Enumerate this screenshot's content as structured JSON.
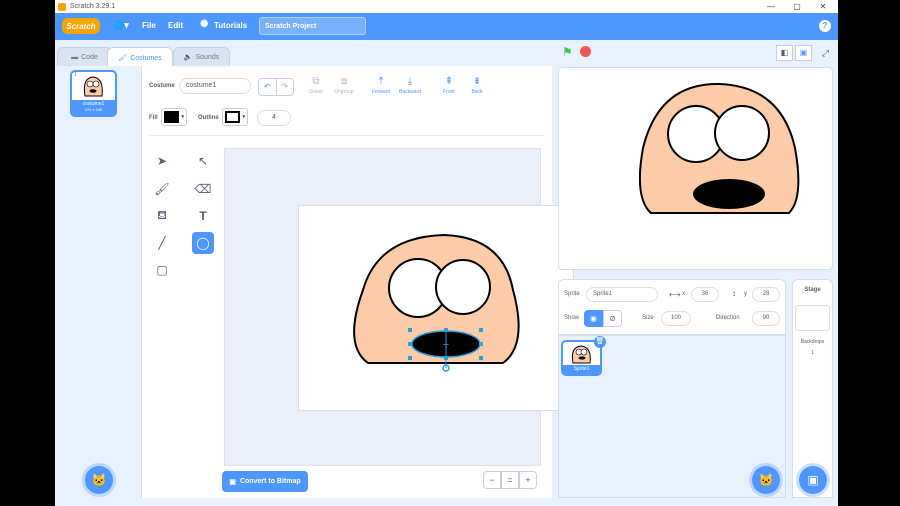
{
  "window": {
    "title": "Scratch 3.29.1",
    "minimize": "—",
    "maximize": "▢",
    "close": "✕"
  },
  "menubar": {
    "logo": "Scratch",
    "globe": "🌐▾",
    "file": "File",
    "edit": "Edit",
    "tutorials": "Tutorials",
    "project_title": "Scratch Project",
    "help": "?"
  },
  "tabs": {
    "code": "Code",
    "costumes": "Costumes",
    "sounds": "Sounds"
  },
  "costume_list": {
    "index": "1",
    "name": "costume1",
    "size": "274 x 240"
  },
  "paint": {
    "costume_label": "Costume",
    "costume_name": "costume1",
    "undo": "↶",
    "redo": "↷",
    "group": "Group",
    "ungroup": "Ungroup",
    "forward": "Forward",
    "backward": "Backward",
    "front": "Front",
    "back": "Back",
    "fill_label": "Fill",
    "outline_label": "Outline",
    "outline_width": "4",
    "convert_button": "Convert to Bitmap",
    "zoom_out": "−",
    "zoom_reset": "=",
    "zoom_in": "+",
    "tools": [
      "select-tool",
      "reshape-tool",
      "brush-tool",
      "eraser-tool",
      "fill-tool",
      "text-tool",
      "line-tool",
      "circle-tool",
      "rect-tool"
    ],
    "active_tool": "circle-tool",
    "fill_color": "#000000",
    "outline_color": "#000000"
  },
  "sprite_info": {
    "sprite_label": "Sprite",
    "sprite_name": "Sprite1",
    "x_label": "x",
    "x_value": "36",
    "y_label": "y",
    "y_value": "28",
    "show_label": "Show",
    "size_label": "Size",
    "size_value": "100",
    "direction_label": "Direction",
    "direction_value": "90"
  },
  "sprites": [
    {
      "name": "Sprite1"
    }
  ],
  "stage_panel": {
    "title": "Stage",
    "backdrops_label": "Backdrops",
    "backdrops_count": "1"
  },
  "colors": {
    "accent": "#4d97ff",
    "face": "#ffccaa",
    "logo": "#f7a500",
    "green_flag": "#4cbf56",
    "stop": "#ec5959"
  }
}
